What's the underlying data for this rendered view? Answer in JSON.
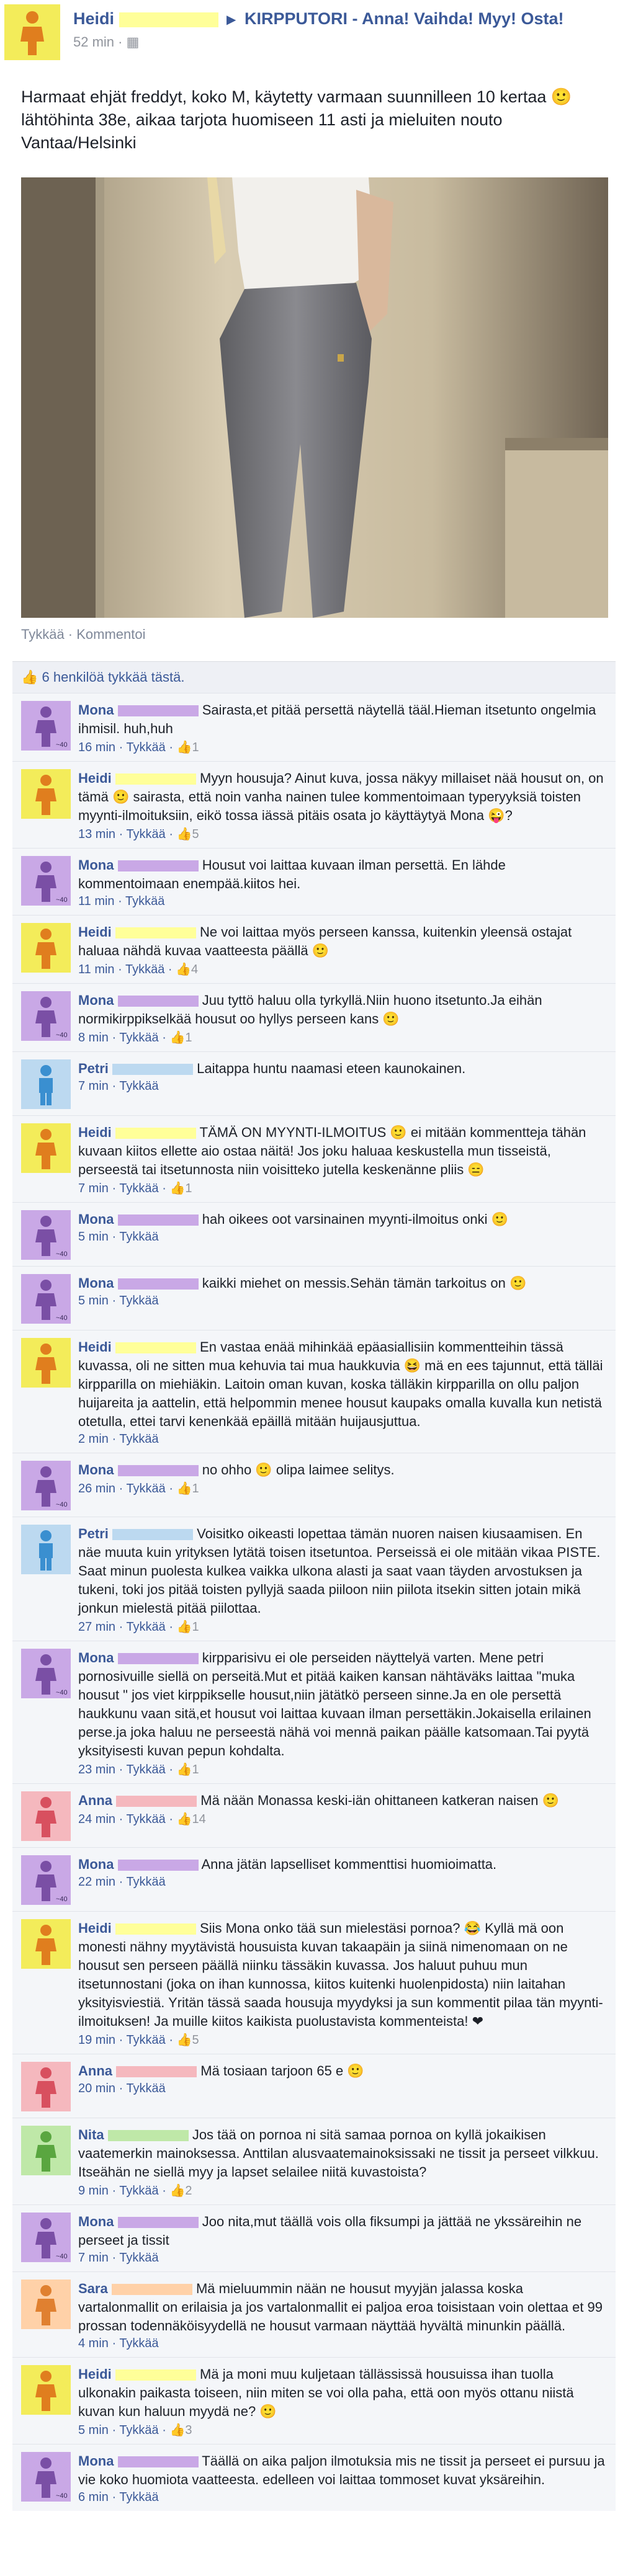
{
  "post": {
    "author": "Heidi",
    "author_redact_color": "#ffff99",
    "group": "KIRPPUTORI - Anna! Vaihda! Myy! Osta!",
    "time": "52 min",
    "text": "Harmaat ehjät freddyt, koko M, käytetty varmaan suunnilleen 10 kertaa 🙂 lähtöhinta 38e, aikaa tarjota huomiseen 11 asti ja mieluiten nouto Vantaa/Helsinki",
    "actions": "Tykkää · Kommentoi",
    "likes": "6 henkilöä tykkää tästä."
  },
  "comments": [
    {
      "name": "Mona",
      "avatar": "mona",
      "redact": "#c9a8e6",
      "text": "Sairasta,et pitää persettä näytellä tääl.Hieman itsetunto ongelmia ihmisil. huh,huh",
      "meta": "16 min · Tykkää · ",
      "likes": "1"
    },
    {
      "name": "Heidi",
      "avatar": "heidi",
      "redact": "#ffff99",
      "text": "Myyn housuja? Ainut kuva, jossa näkyy millaiset nää housut on, on tämä 🙂 sairasta, että noin vanha nainen tulee kommentoimaan typeryyksiä toisten myynti-ilmoituksiin, eikö tossa iässä pitäis osata jo käyttäytyä Mona 😜?",
      "meta": "13 min · Tykkää · ",
      "likes": "5"
    },
    {
      "name": "Mona",
      "avatar": "mona",
      "redact": "#c9a8e6",
      "text": "Housut voi laittaa kuvaan ilman persettä. En lähde kommentoimaan enempää.kiitos hei.",
      "meta": "11 min · Tykkää",
      "likes": ""
    },
    {
      "name": "Heidi",
      "avatar": "heidi",
      "redact": "#ffff99",
      "text": "Ne voi laittaa myös perseen kanssa, kuitenkin yleensä ostajat haluaa nähdä kuvaa vaatteesta päällä 🙂",
      "meta": "11 min · Tykkää · ",
      "likes": "4"
    },
    {
      "name": "Mona",
      "avatar": "mona",
      "redact": "#c9a8e6",
      "text": "Juu tyttö haluu olla tyrkyllä.Niin huono itsetunto.Ja eihän normikirppikselkää housut oo hyllys perseen kans 🙂",
      "meta": "8 min · Tykkää · ",
      "likes": "1"
    },
    {
      "name": "Petri",
      "avatar": "petri",
      "redact": "#bcd9f0",
      "text": "Laitappa huntu naamasi eteen kaunokainen.",
      "meta": "7 min · Tykkää",
      "likes": ""
    },
    {
      "name": "Heidi",
      "avatar": "heidi",
      "redact": "#ffff99",
      "text": "TÄMÄ ON MYYNTI-ILMOITUS 🙂 ei mitään kommentteja tähän kuvaan kiitos ellette aio ostaa näitä! Jos joku haluaa keskustella mun tisseistä, perseestä tai itsetunnosta niin voisitteko jutella keskenänne pliis 😑",
      "meta": "7 min · Tykkää · ",
      "likes": "1"
    },
    {
      "name": "Mona",
      "avatar": "mona",
      "redact": "#c9a8e6",
      "text": "hah oikees oot varsinainen myynti-ilmoitus onki 🙂",
      "meta": "5 min · Tykkää",
      "likes": ""
    },
    {
      "name": "Mona",
      "avatar": "mona",
      "redact": "#c9a8e6",
      "text": "kaikki miehet on messis.Sehän tämän tarkoitus on 🙂",
      "meta": "5 min · Tykkää",
      "likes": ""
    },
    {
      "name": "Heidi",
      "avatar": "heidi",
      "redact": "#ffff99",
      "text": "En vastaa enää mihinkää epäasiallisiin kommentteihin tässä kuvassa, oli ne sitten mua kehuvia tai mua haukkuvia 😆 mä en ees tajunnut, että tälläi kirpparilla on miehiäkin. Laitoin oman kuvan, koska tälläkin kirpparilla on ollu paljon huijareita ja aattelin, että helpommin menee housut kaupaks omalla kuvalla kun netistä otetulla, ettei tarvi kenenkää epäillä mitään huijausjuttua.",
      "meta": "2 min · Tykkää",
      "likes": ""
    },
    {
      "name": "Mona",
      "avatar": "mona",
      "redact": "#c9a8e6",
      "text": "no ohho 🙂 olipa laimee selitys.",
      "meta": "26 min · Tykkää · ",
      "likes": "1"
    },
    {
      "name": "Petri",
      "avatar": "petri",
      "redact": "#bcd9f0",
      "text": "Voisitko oikeasti lopettaa tämän nuoren naisen kiusaamisen. En näe muuta kuin yrityksen lytätä toisen itsetuntoa. Perseissä ei ole mitään vikaa PISTE. Saat minun puolesta kulkea vaikka ulkona alasti ja saat vaan täyden arvostuksen ja tukeni, toki jos pitää toisten pyllyjä saada piiloon niin piilota itsekin sitten jotain mikä jonkun mielestä pitää piilottaa.",
      "meta": "27 min · Tykkää · ",
      "likes": "1"
    },
    {
      "name": "Mona",
      "avatar": "mona",
      "redact": "#c9a8e6",
      "text": "kirpparisivu ei ole perseiden näyttelyä varten. Mene petri pornosivuille siellä on perseitä.Mut et pitää kaiken kansan nähtäväks laittaa \"muka housut \" jos viet kirppikselle housut,niin jätätkö perseen sinne.Ja en ole persettä haukkunu vaan sitä,et housut voi laittaa kuvaan ilman persettäkin.Jokaisella erilainen perse.ja joka haluu ne perseestä nähä voi mennä paikan päälle katsomaan.Tai pyytä yksityisesti kuvan pepun kohdalta.",
      "meta": "23 min · Tykkää · ",
      "likes": "1"
    },
    {
      "name": "Anna",
      "avatar": "anna",
      "redact": "#f5b8be",
      "text": "Mä nään Monassa keski-iän ohittaneen katkeran naisen 🙂",
      "meta": "24 min · Tykkää · ",
      "likes": "14"
    },
    {
      "name": "Mona",
      "avatar": "mona",
      "redact": "#c9a8e6",
      "text": "Anna jätän lapselliset kommenttisi huomioimatta.",
      "meta": "22 min · Tykkää",
      "likes": ""
    },
    {
      "name": "Heidi",
      "avatar": "heidi",
      "redact": "#ffff99",
      "text": "Siis Mona onko tää sun mielestäsi pornoa? 😂 Kyllä mä oon monesti nähny myytävistä housuista kuvan takaapäin ja siinä nimenomaan on ne housut sen perseen päällä niinku tässäkin kuvassa. Jos haluut puhuu mun itsetunnostani (joka on ihan kunnossa, kiitos kuitenki huolenpidosta) niin laitahan yksityisviestiä. Yritän tässä saada housuja myydyksi ja sun kommentit pilaa tän myynti-ilmoituksen! Ja muille kiitos kaikista puolustavista kommenteista! ❤",
      "meta": "19 min · Tykkää · ",
      "likes": "5"
    },
    {
      "name": "Anna",
      "avatar": "anna",
      "redact": "#f5b8be",
      "text": "Mä tosiaan tarjoon 65 e 🙂",
      "meta": "20 min · Tykkää",
      "likes": ""
    },
    {
      "name": "Nita",
      "avatar": "nita",
      "redact": "#bfe8a8",
      "text": "Jos tää on pornoa ni sitä samaa pornoa on kyllä jokaikisen vaatemerkin mainoksessa. Anttilan alusvaatemainoksissaki ne tissit ja perseet vilkkuu. Itseähän ne siellä myy ja lapset selailee niitä kuvastoista?",
      "meta": "9 min · Tykkää · ",
      "likes": "2"
    },
    {
      "name": "Mona",
      "avatar": "mona",
      "redact": "#c9a8e6",
      "text": "Joo nita,mut täällä vois olla fiksumpi ja jättää ne ykssäreihin ne perseet ja tissit",
      "meta": "7 min · Tykkää",
      "likes": ""
    },
    {
      "name": "Sara",
      "avatar": "sara",
      "redact": "#ffd1a8",
      "text": "Mä mieluummin nään ne housut myyjän jalassa koska vartalonmallit on erilaisia ja jos vartalonmallit ei paljoa eroa toisistaan voin olettaa et 99 prossan todennäköisyydellä ne housut varmaan näyttää hyvältä minunkin päällä.",
      "meta": "4 min · Tykkää",
      "likes": ""
    },
    {
      "name": "Heidi",
      "avatar": "heidi",
      "redact": "#ffff99",
      "text": "Mä ja moni muu kuljetaan tällässissä housuissa ihan tuolla ulkonakin paikasta toiseen, niin miten se voi olla paha, että oon myös ottanu niistä kuvan kun haluun myydä ne? 🙂",
      "meta": "5 min · Tykkää · ",
      "likes": "3"
    },
    {
      "name": "Mona",
      "avatar": "mona",
      "redact": "#c9a8e6",
      "text": "Täällä on aika paljon ilmotuksia mis ne tissit ja perseet ei pursuu ja vie koko huomiota vaatteesta. edelleen voi laittaa tommoset kuvat yksäreihin.",
      "meta": "6 min · Tykkää",
      "likes": ""
    }
  ]
}
